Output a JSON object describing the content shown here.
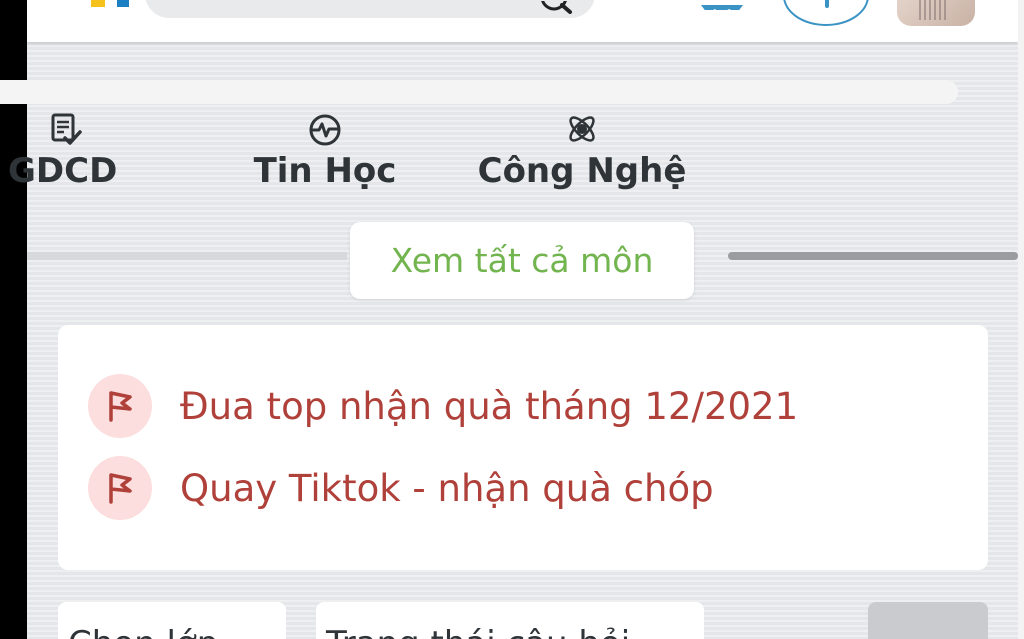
{
  "subjects": [
    {
      "label": "GDCD",
      "icon": "document-check-icon"
    },
    {
      "label": "Tin Học",
      "icon": "heartbeat-icon"
    },
    {
      "label": "Công Nghệ",
      "icon": "atom-icon"
    }
  ],
  "see_all_label": "Xem tất cả môn",
  "promotions": [
    {
      "label": "Đua top nhận quà tháng 12/2021",
      "icon": "flag-icon"
    },
    {
      "label": "Quay Tiktok - nhận quà chóp",
      "icon": "flag-icon"
    }
  ],
  "filters": {
    "class_label": "Chọn lớp",
    "status_label": "Trạng thái câu hỏi"
  },
  "colors": {
    "accent_green": "#72b44e",
    "promo_red": "#b0403a",
    "promo_icon_bg": "#fbdedd",
    "brand_blue": "#1b7fc4",
    "brand_yellow": "#f4c21b"
  }
}
